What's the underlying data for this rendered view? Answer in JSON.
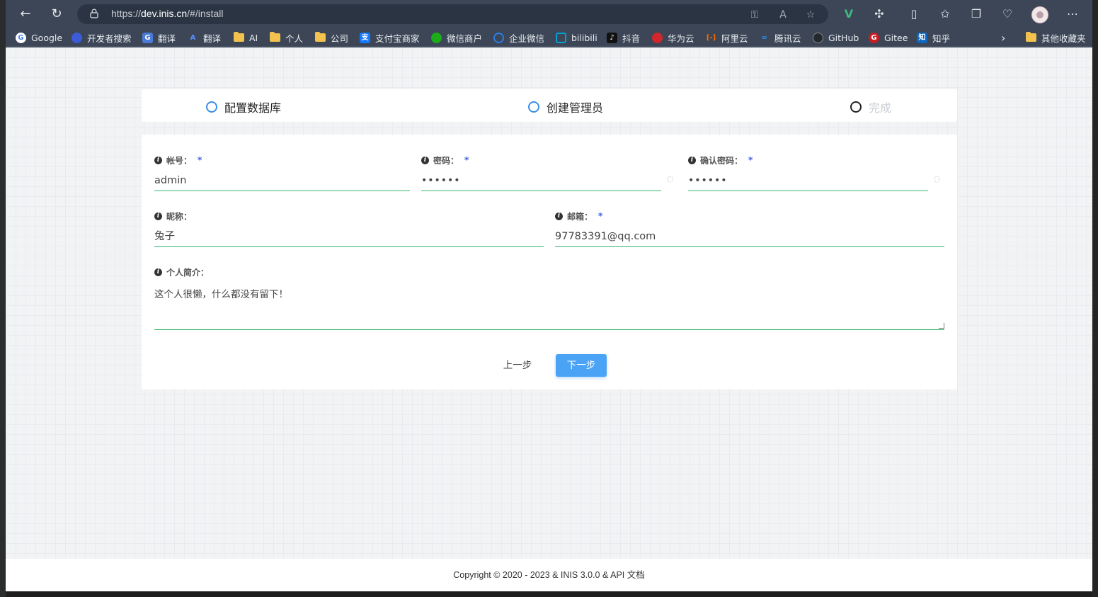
{
  "browser": {
    "url_scheme": "https://",
    "url_host": "dev.inis.cn",
    "url_path": "/#/install"
  },
  "bookmarks": [
    {
      "label": "Google",
      "icon": "google-icon",
      "color": "#4285f4"
    },
    {
      "label": "开发者搜索",
      "icon": "dev-search-icon",
      "color": "#3b5bdb"
    },
    {
      "label": "翻译",
      "icon": "google-translate-icon",
      "color": "#4a7bd8"
    },
    {
      "label": "翻译",
      "icon": "translate-icon",
      "color": "#2d6be0"
    },
    {
      "label": "AI",
      "icon": "folder-icon"
    },
    {
      "label": "个人",
      "icon": "folder-icon"
    },
    {
      "label": "公司",
      "icon": "folder-icon"
    },
    {
      "label": "支付宝商家",
      "icon": "alipay-icon",
      "color": "#1677ff"
    },
    {
      "label": "微信商户",
      "icon": "wechat-pay-icon",
      "color": "#1aad19"
    },
    {
      "label": "企业微信",
      "icon": "wecom-icon",
      "color": "#2b7de9"
    },
    {
      "label": "bilibili",
      "icon": "bilibili-icon",
      "color": "#00a1d6"
    },
    {
      "label": "抖音",
      "icon": "douyin-icon",
      "color": "#111111"
    },
    {
      "label": "华为云",
      "icon": "huawei-icon",
      "color": "#d1272c"
    },
    {
      "label": "阿里云",
      "icon": "aliyun-icon",
      "color": "#ff6a00"
    },
    {
      "label": "腾讯云",
      "icon": "tencent-cloud-icon",
      "color": "#2c8ef8"
    },
    {
      "label": "GitHub",
      "icon": "github-icon",
      "color": "#24292e"
    },
    {
      "label": "Gitee",
      "icon": "gitee-icon",
      "color": "#c71d23"
    },
    {
      "label": "知乎",
      "icon": "zhihu-icon",
      "color": "#0a66c2"
    }
  ],
  "other_bookmarks": "其他收藏夹",
  "steps": [
    {
      "label": "配置数据库"
    },
    {
      "label": "创建管理员"
    },
    {
      "label": "完成"
    }
  ],
  "form": {
    "account": {
      "label": "帐号：",
      "required": "*",
      "value": "admin"
    },
    "password": {
      "label": "密码：",
      "required": "*",
      "value": "••••••"
    },
    "confirm_password": {
      "label": "确认密码：",
      "required": "*",
      "value": "••••••"
    },
    "nickname": {
      "label": "昵称：",
      "value": "兔子"
    },
    "email": {
      "label": "邮箱：",
      "required": "*",
      "value": "97783391@qq.com"
    },
    "bio": {
      "label": "个人简介：",
      "value": "这个人很懒，什么都没有留下！"
    },
    "info_glyph": "i",
    "eye_glyph": "◌"
  },
  "buttons": {
    "prev": "上一步",
    "next": "下一步"
  },
  "footer": "Copyright © 2020 - 2023 & INIS 3.0.0 & API 文档",
  "colors": {
    "accent": "#4aa3f5",
    "input_underline": "#35b56a",
    "step_active": "#3a8ee6",
    "browser_chrome": "#3c4656"
  }
}
